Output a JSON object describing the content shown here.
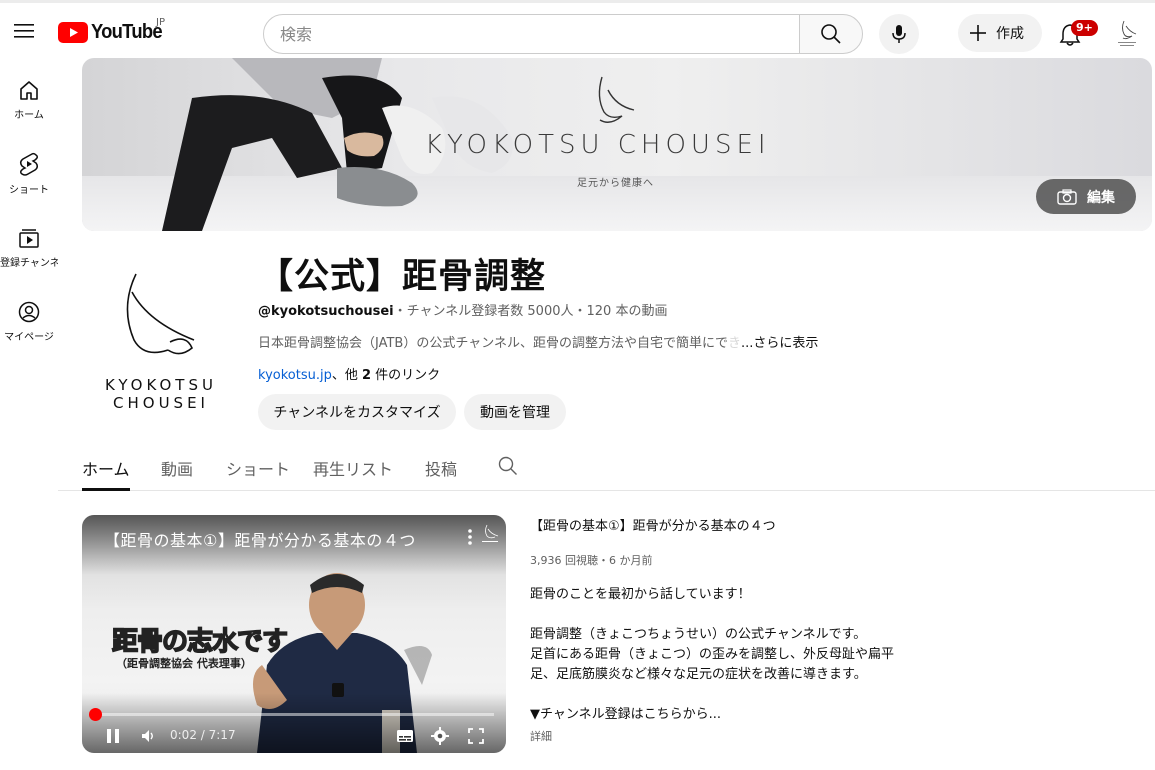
{
  "header": {
    "logo_text": "YouTube",
    "region": "JP",
    "search_placeholder": "検索",
    "create_label": "作成",
    "notification_count": "9+",
    "avatar_icon": "kyokotsu-logo-icon"
  },
  "sidebar": {
    "items": [
      {
        "label": "ホーム",
        "icon": "home-icon"
      },
      {
        "label": "ショート",
        "icon": "shorts-icon"
      },
      {
        "label": "登録チャンネル",
        "icon": "subscriptions-icon"
      },
      {
        "label": "マイページ",
        "icon": "you-icon"
      }
    ]
  },
  "banner": {
    "title": "KYOKOTSU CHOUSEI",
    "subtitle": "足元から健康へ",
    "edit_label": "編集"
  },
  "channel": {
    "avatar_text_line1": "KYOKOTSU",
    "avatar_text_line2": "CHOUSEI",
    "title": "【公式】距骨調整",
    "handle": "@kyokotsuchousei",
    "subscribers": "チャンネル登録者数 5000人",
    "video_count": "120 本の動画",
    "meta_separator": "・",
    "description": "日本距骨調整協会（JATB）の公式チャンネル、距骨の調整方法や自宅で簡単にで",
    "description_fade": "き",
    "more_label": "...さらに表示",
    "link_url": "kyokotsu.jp",
    "link_suffix_pre": "、他 ",
    "link_count": "2",
    "link_suffix_post": " 件のリンク",
    "customize_label": "チャンネルをカスタマイズ",
    "manage_label": "動画を管理"
  },
  "tabs": [
    {
      "label": "ホーム",
      "active": true
    },
    {
      "label": "動画",
      "active": false
    },
    {
      "label": "ショート",
      "active": false
    },
    {
      "label": "再生リスト",
      "active": false
    },
    {
      "label": "投稿",
      "active": false
    }
  ],
  "video": {
    "player_title": "【距骨の基本①】距骨が分かる基本の４つ",
    "overlay_main": "距骨の志水です",
    "overlay_sub": "（距骨調整協会 代表理事）",
    "current_time": "0:02",
    "duration": "7:17",
    "progress_fraction": 0.005,
    "title": "【距骨の基本①】距骨が分かる基本の４つ",
    "views": "3,936 回視聴",
    "age": "6 か月前",
    "stats_separator": "・",
    "desc_line1": "距骨のことを最初から話しています！",
    "desc_line2": "距骨調整（きょこつちょうせい）の公式チャンネルです。",
    "desc_line3": "足首にある距骨（きょこつ）の歪みを調整し、外反母趾や扁平",
    "desc_line4": "足、足底筋膜炎など様々な足元の症状を改善に導きます。",
    "desc_line5": "▼チャンネル登録はこちらから...",
    "more_label": "詳細"
  },
  "colors": {
    "brand_red": "#ff0000",
    "link_blue": "#065fd4",
    "badge_red": "#cc0000"
  }
}
